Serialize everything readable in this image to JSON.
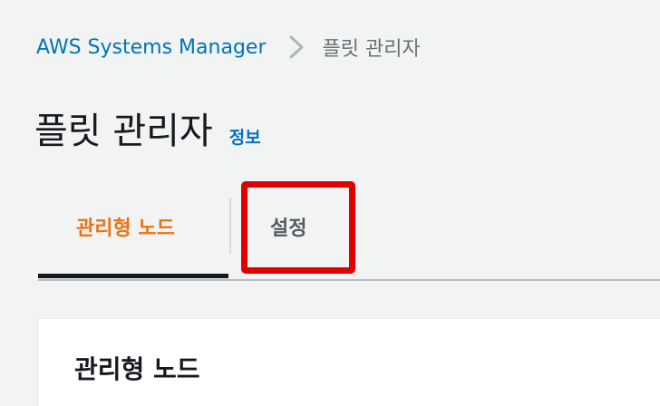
{
  "breadcrumb": {
    "service": "AWS Systems Manager",
    "separator_icon": "chevron-right-icon",
    "current": "플릿 관리자"
  },
  "header": {
    "title": "플릿 관리자",
    "info_link": "정보"
  },
  "tabs": [
    {
      "label": "관리형 노드",
      "active": true
    },
    {
      "label": "설정",
      "active": false,
      "highlighted": true
    }
  ],
  "main": {
    "container_title": "관리형 노드"
  },
  "colors": {
    "link": "#0073bb",
    "active_tab": "#ec7211",
    "highlight": "#e00000",
    "background": "#f2f3f3"
  }
}
